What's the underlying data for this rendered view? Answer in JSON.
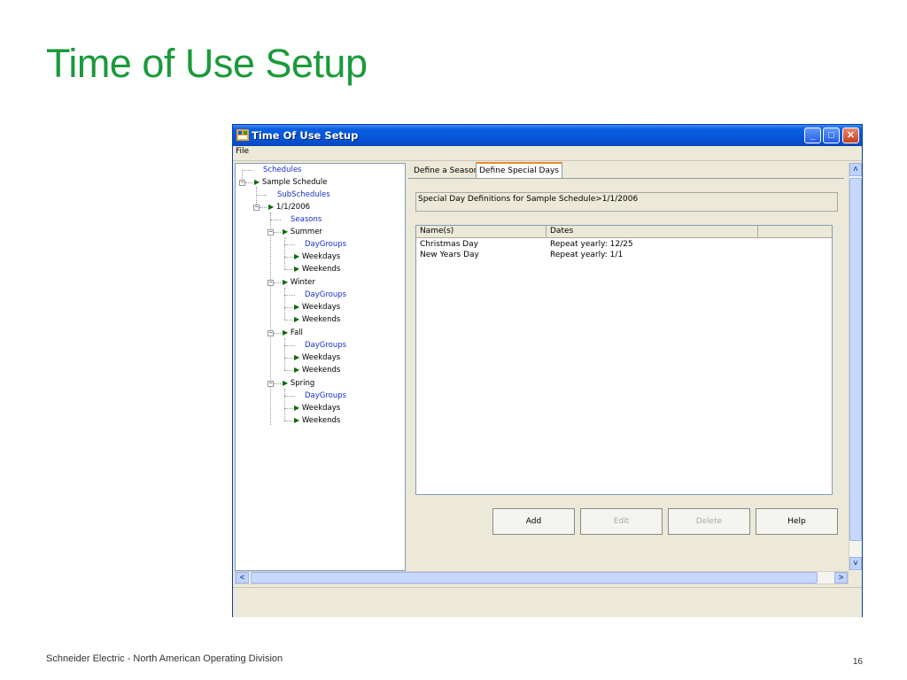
{
  "slide": {
    "title": "Time of Use Setup",
    "footer_left": "Schneider Electric - North American Operating Division",
    "page_number": "16"
  },
  "window": {
    "title": "Time Of Use Setup",
    "menu": [
      "File"
    ]
  },
  "tree": {
    "nodes": [
      {
        "label": "Schedules",
        "link": true
      },
      {
        "label": "Sample Schedule",
        "link": false
      },
      {
        "label": "SubSchedules",
        "link": true
      },
      {
        "label": "1/1/2006",
        "link": false
      },
      {
        "label": "Seasons",
        "link": true
      },
      {
        "label": "Summer",
        "link": false
      },
      {
        "label": "DayGroups",
        "link": true
      },
      {
        "label": "Weekdays",
        "link": false
      },
      {
        "label": "Weekends",
        "link": false
      },
      {
        "label": "Winter",
        "link": false
      },
      {
        "label": "DayGroups",
        "link": true
      },
      {
        "label": "Weekdays",
        "link": false
      },
      {
        "label": "Weekends",
        "link": false
      },
      {
        "label": "Fall",
        "link": false
      },
      {
        "label": "DayGroups",
        "link": true
      },
      {
        "label": "Weekdays",
        "link": false
      },
      {
        "label": "Weekends",
        "link": false
      },
      {
        "label": "Spring",
        "link": false
      },
      {
        "label": "DayGroups",
        "link": true
      },
      {
        "label": "Weekdays",
        "link": false
      },
      {
        "label": "Weekends",
        "link": false
      }
    ]
  },
  "tabs": [
    "Define a Season",
    "Define Special Days"
  ],
  "active_tab": "Define Special Days",
  "definition_caption": "Special Day Definitions for Sample Schedule>1/1/2006",
  "table": {
    "columns": [
      "Name(s)",
      "Dates"
    ],
    "rows": [
      [
        "Christmas Day",
        "Repeat yearly: 12/25"
      ],
      [
        "New Years Day",
        "Repeat yearly: 1/1"
      ]
    ]
  },
  "buttons": {
    "add": "Add",
    "edit": "Edit",
    "delete": "Delete",
    "help": "Help"
  },
  "colors": {
    "title_green": "#1a9a3a",
    "xp_titlebar": "#0553d8",
    "link_blue": "#1a2fd0"
  }
}
